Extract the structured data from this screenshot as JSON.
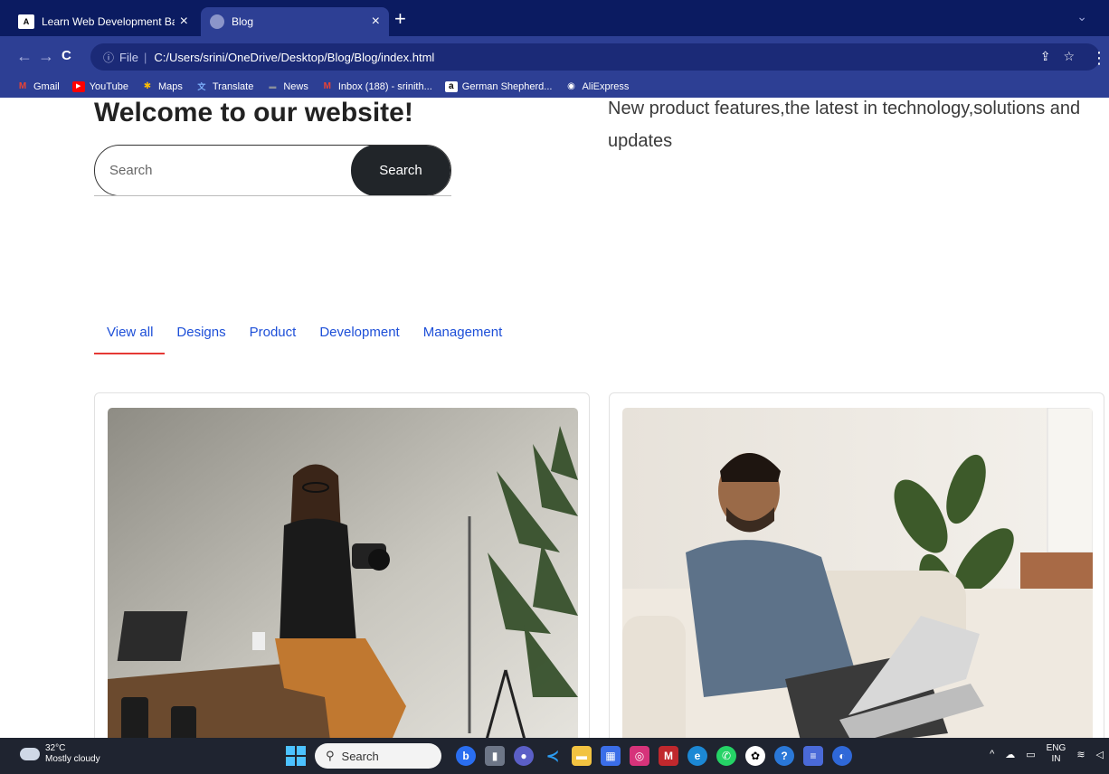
{
  "browser": {
    "tabs": [
      {
        "favicon": "A",
        "title": "Learn Web Development Basics –",
        "close": "×"
      },
      {
        "favicon": "globe",
        "title": "Blog",
        "close": "×"
      }
    ],
    "new_tab": "+",
    "tab_menu": "⌄",
    "nav": {
      "back": "←",
      "forward": "→",
      "reload": "C"
    },
    "address": {
      "info": "ⓘ",
      "scheme": "File",
      "separator": "|",
      "url": "C:/Users/srini/OneDrive/Desktop/Blog/Blog/index.html"
    },
    "address_actions": "⇪☆",
    "menu": "⋮",
    "bookmarks": [
      {
        "label": "Gmail",
        "icon": "M",
        "color": "#ea4335"
      },
      {
        "label": "YouTube",
        "icon": "▶",
        "color": "#ff0000"
      },
      {
        "label": "Maps",
        "icon": "✱",
        "color": "#fbbc04"
      },
      {
        "label": "Translate",
        "icon": "文",
        "color": "#4285f4"
      },
      {
        "label": "News",
        "icon": "▬",
        "color": "#5f6368"
      },
      {
        "label": "Inbox (188) - srinith...",
        "icon": "M",
        "color": "#ea4335"
      },
      {
        "label": "German Shepherd...",
        "icon": "a",
        "color": "#ffffff"
      },
      {
        "label": "AliExpress",
        "icon": "◉",
        "color": "#ffffff"
      }
    ]
  },
  "page": {
    "welcome": "Welcome to our website!",
    "tagline": "New product features,the latest in technology,solutions and updates",
    "search": {
      "placeholder": "Search",
      "button": "Search"
    },
    "filters": [
      "View all",
      "Designs",
      "Product",
      "Development",
      "Management"
    ],
    "active_filter": "View all"
  },
  "taskbar": {
    "temperature": "32°C",
    "weather": "Mostly cloudy",
    "search_placeholder": "Search",
    "language": "ENG",
    "region": "IN"
  }
}
